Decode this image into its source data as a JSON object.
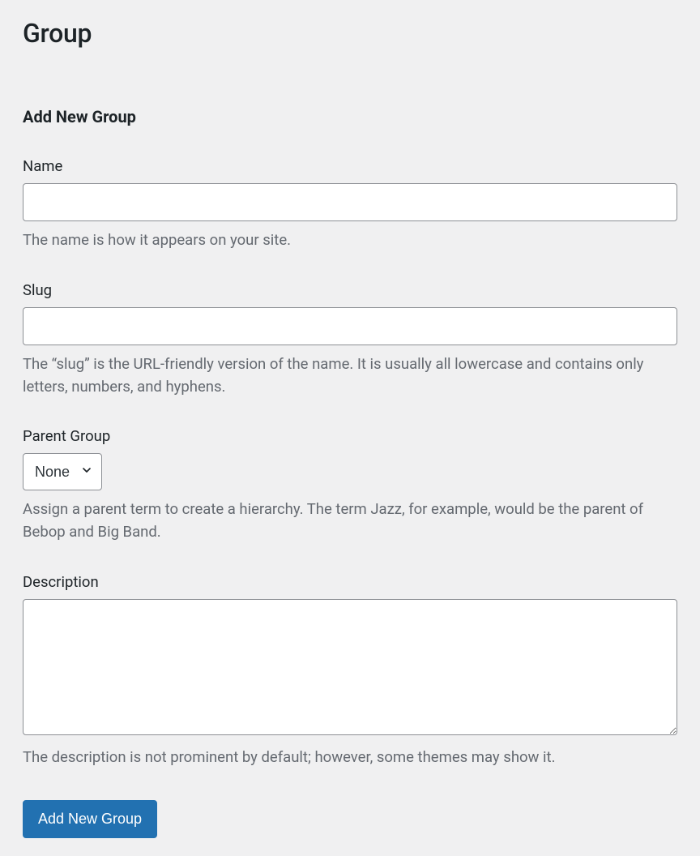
{
  "page": {
    "title": "Group"
  },
  "form": {
    "title": "Add New Group",
    "fields": {
      "name": {
        "label": "Name",
        "value": "",
        "help": "The name is how it appears on your site."
      },
      "slug": {
        "label": "Slug",
        "value": "",
        "help": "The “slug” is the URL-friendly version of the name. It is usually all lowercase and contains only letters, numbers, and hyphens."
      },
      "parent": {
        "label": "Parent Group",
        "selected": "None",
        "help": "Assign a parent term to create a hierarchy. The term Jazz, for example, would be the parent of Bebop and Big Band."
      },
      "description": {
        "label": "Description",
        "value": "",
        "help": "The description is not prominent by default; however, some themes may show it."
      }
    },
    "submit_label": "Add New Group"
  }
}
